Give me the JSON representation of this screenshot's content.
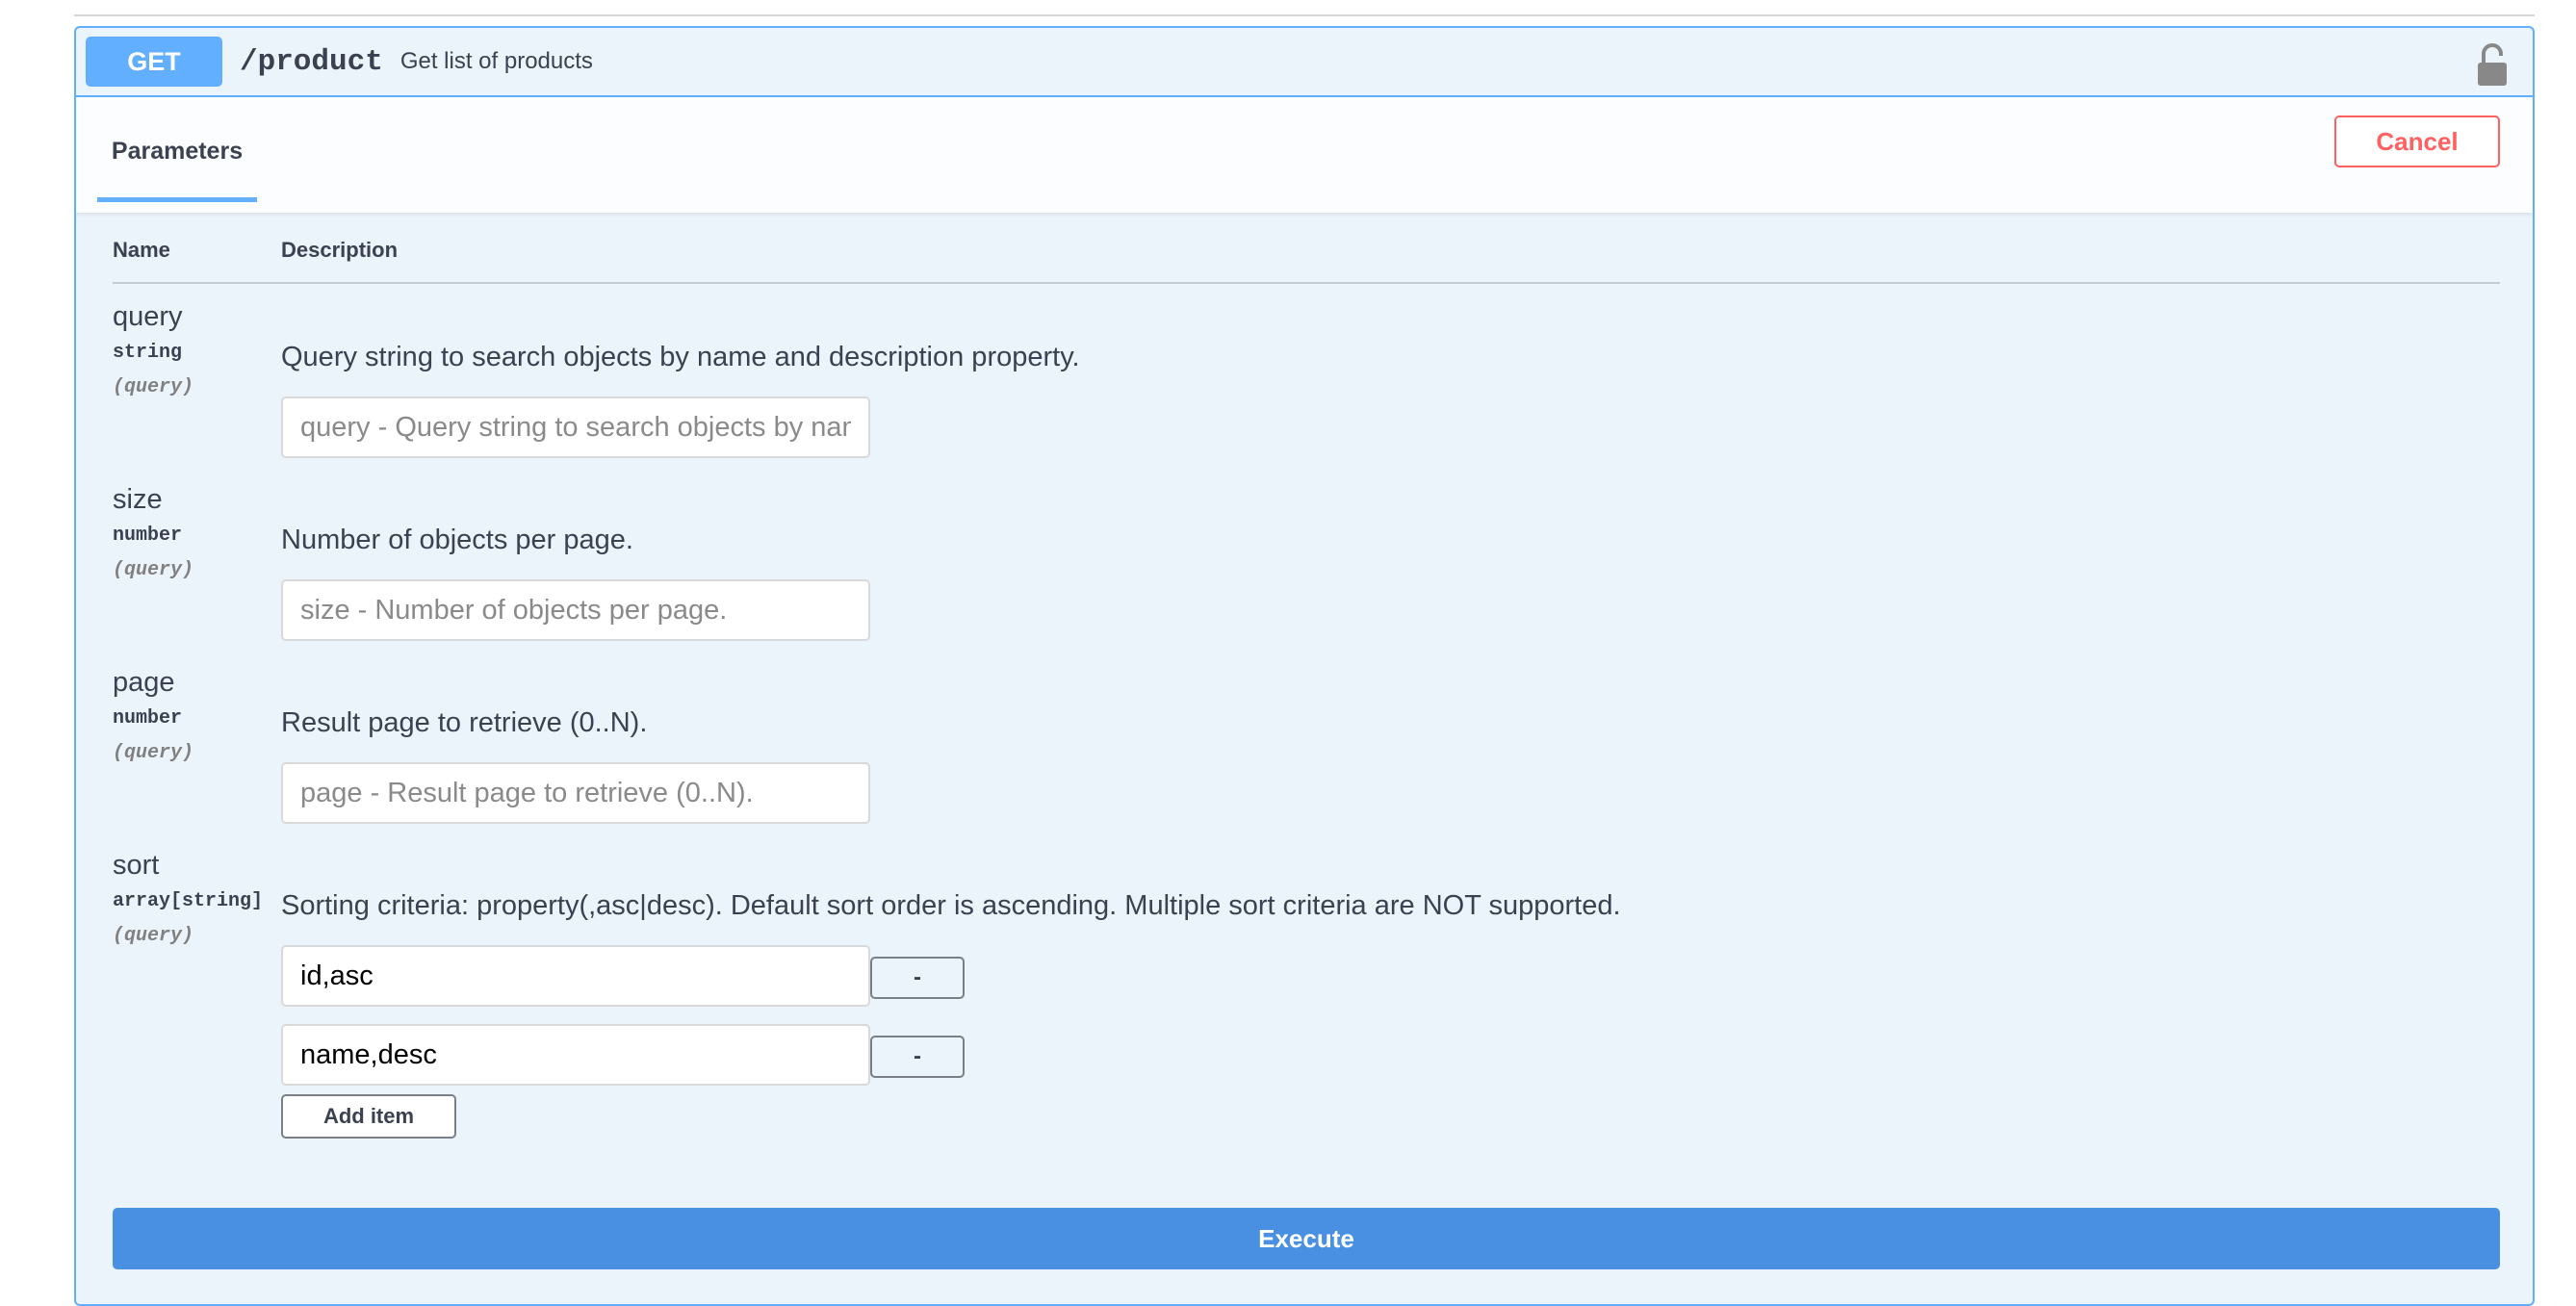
{
  "operation": {
    "method": "GET",
    "path": "/product",
    "summary": "Get list of products",
    "lock_icon": "unlocked-padlock-icon"
  },
  "section": {
    "tab_label": "Parameters",
    "cancel_label": "Cancel"
  },
  "table": {
    "col_name": "Name",
    "col_description": "Description"
  },
  "params": [
    {
      "name": "query",
      "type": "string",
      "in": "(query)",
      "description": "Query string to search objects by name and description property.",
      "placeholder": "query - Query string to search objects by name and description property."
    },
    {
      "name": "size",
      "type": "number",
      "in": "(query)",
      "description": "Number of objects per page.",
      "placeholder": "size - Number of objects per page."
    },
    {
      "name": "page",
      "type": "number",
      "in": "(query)",
      "description": "Result page to retrieve (0..N).",
      "placeholder": "page - Result page to retrieve (0..N)."
    },
    {
      "name": "sort",
      "type": "array[string]",
      "in": "(query)",
      "description": "Sorting criteria: property(,asc|desc). Default sort order is ascending. Multiple sort criteria are NOT supported.",
      "items": [
        "id,asc",
        "name,desc"
      ],
      "remove_label": "-",
      "add_label": "Add item"
    }
  ],
  "execute_label": "Execute",
  "colors": {
    "get_blue": "#61affe",
    "execute_blue": "#4990e2",
    "cancel_red": "#ff6060",
    "panel_bg": "#ebf3fb"
  }
}
